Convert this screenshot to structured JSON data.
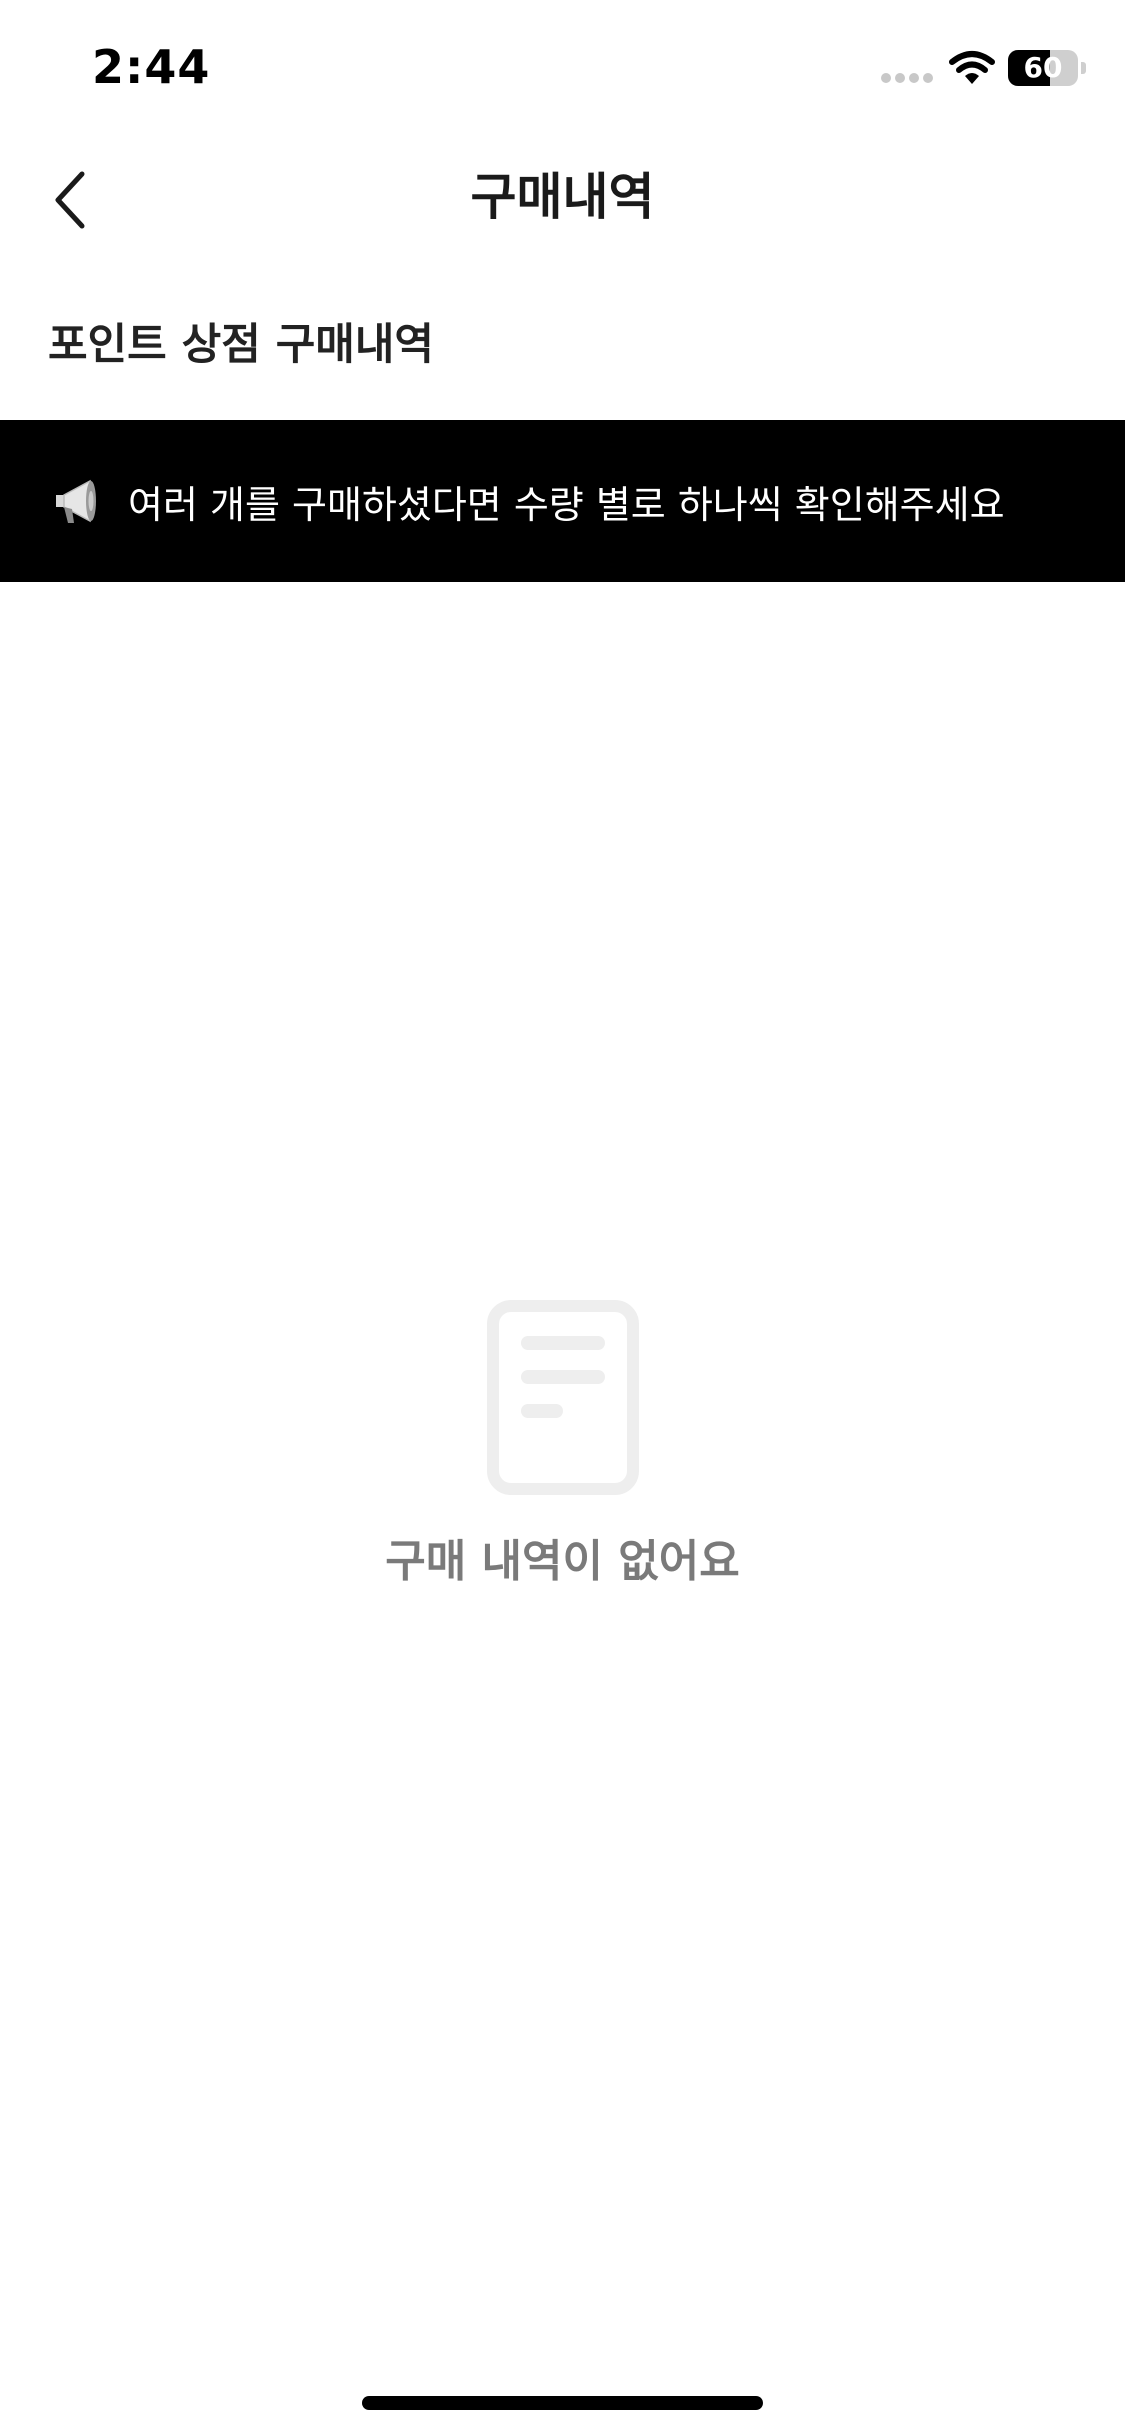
{
  "status_bar": {
    "time": "2:44",
    "battery_level": "60",
    "battery_fraction": 0.6,
    "icons": [
      "signal-dots-icon",
      "wifi-icon",
      "battery-icon"
    ]
  },
  "nav": {
    "title": "구매내역",
    "back_icon": "chevron-left-icon"
  },
  "section": {
    "title": "포인트 상점 구매내역"
  },
  "notice": {
    "icon": "megaphone-icon",
    "text": "여러 개를 구매하셨다면 수량 별로 하나씩 확인해주세요"
  },
  "empty_state": {
    "icon": "document-icon",
    "message": "구매 내역이 없어요"
  },
  "colors": {
    "banner_background": "#000000",
    "banner_text": "#ffffff",
    "empty_text": "#7a7a7a",
    "empty_icon": "#eeeeee"
  }
}
